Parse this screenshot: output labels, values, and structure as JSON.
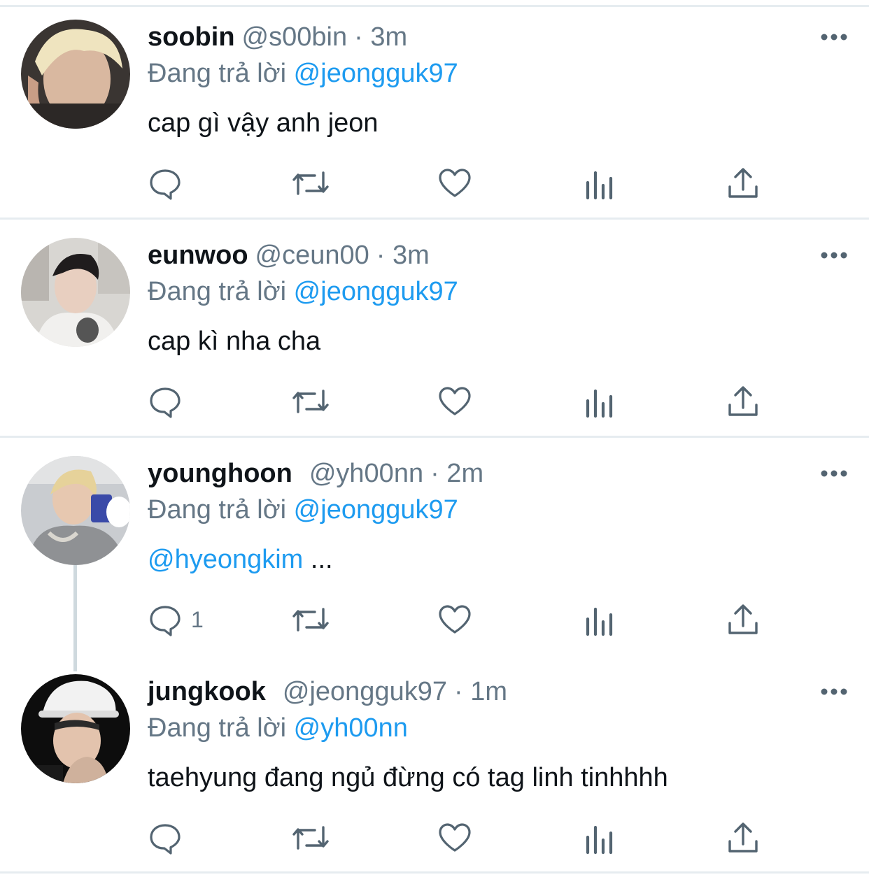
{
  "tweets": [
    {
      "name": "soobin",
      "handle": "@s00bin",
      "time": "· 3m",
      "replying_prefix": "Đang trả lời",
      "replying_to": "@jeongguk97",
      "text": "cap gì vậy anh jeon",
      "reply_count": ""
    },
    {
      "name": "eunwoo",
      "handle": "@ceun00",
      "time": "· 3m",
      "replying_prefix": "Đang trả lời",
      "replying_to": "@jeongguk97",
      "text": "cap kì nha cha",
      "reply_count": ""
    },
    {
      "name": "younghoon",
      "handle": "@yh00nn",
      "time": "· 2m",
      "replying_prefix": "Đang trả lời",
      "replying_to": "@jeongguk97",
      "text_mention": "@hyeongkim",
      "text": " ...",
      "reply_count": "1"
    },
    {
      "name": "jungkook",
      "handle": "@jeongguk97",
      "time": "· 1m",
      "replying_prefix": "Đang trả lời",
      "replying_to": "@yh00nn",
      "text": "taehyung đang ngủ đừng có tag linh tinhhhh",
      "reply_count": ""
    }
  ],
  "icons": {
    "reply": "reply-icon",
    "retweet": "retweet-icon",
    "like": "heart-icon",
    "analytics": "analytics-icon",
    "share": "share-icon",
    "more": "more-dots-icon"
  },
  "colors": {
    "link": "#1d9bf0",
    "secondary": "#657786",
    "icon": "#536471",
    "divider": "#e6ecf0",
    "thread_line": "#cfd9de"
  }
}
